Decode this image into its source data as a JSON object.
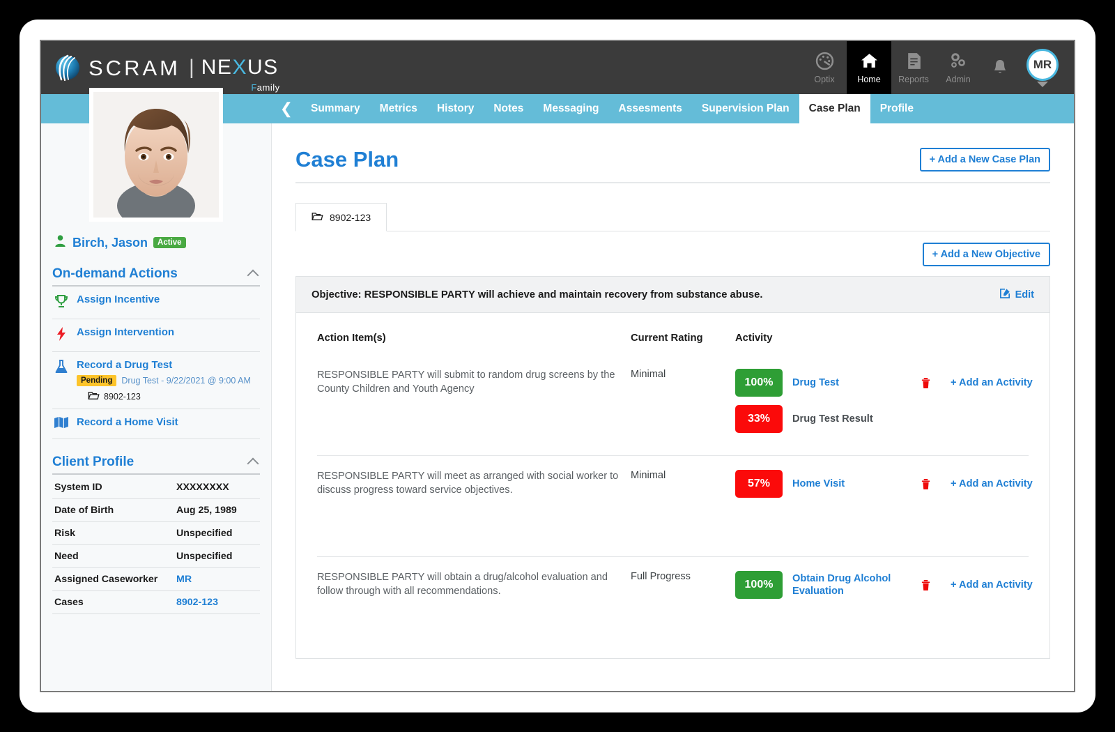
{
  "brand": {
    "name": "SCRAM",
    "separator": "|",
    "product_a": "NE",
    "product_x": "X",
    "product_b": "US",
    "product_sub_f": "F",
    "product_sub_rest": "amily",
    "accent_blue": "#49b8e0"
  },
  "topnav": {
    "items": [
      {
        "label": "Optix",
        "icon": "gauge-icon",
        "active": false
      },
      {
        "label": "Home",
        "icon": "home-icon",
        "active": true
      },
      {
        "label": "Reports",
        "icon": "document-icon",
        "active": false
      },
      {
        "label": "Admin",
        "icon": "gears-icon",
        "active": false
      }
    ],
    "bell_icon": "bell-icon",
    "user_initials": "MR"
  },
  "tabbar": {
    "back_glyph": "❮",
    "tabs": [
      {
        "label": "Summary",
        "active": false
      },
      {
        "label": "Metrics",
        "active": false
      },
      {
        "label": "History",
        "active": false
      },
      {
        "label": "Notes",
        "active": false
      },
      {
        "label": "Messaging",
        "active": false
      },
      {
        "label": "Assesments",
        "active": false
      },
      {
        "label": "Supervision Plan",
        "active": false
      },
      {
        "label": "Case Plan",
        "active": true
      },
      {
        "label": "Profile",
        "active": false
      }
    ]
  },
  "sidebar": {
    "client_name": "Birch, Jason",
    "status_badge": "Active",
    "ondemand": {
      "title": "On-demand Actions",
      "items": [
        {
          "label": "Assign Incentive",
          "icon": "trophy-icon"
        },
        {
          "label": "Assign Intervention",
          "icon": "lightning-bolt-icon"
        },
        {
          "label": "Record a Drug Test",
          "icon": "flask-icon",
          "pending_badge": "Pending",
          "pending_text": "Drug Test - 9/22/2021 @ 9:00 AM",
          "case_number": "8902-123"
        },
        {
          "label": "Record a Home Visit",
          "icon": "map-icon"
        }
      ]
    },
    "client_profile": {
      "title": "Client Profile",
      "rows": [
        {
          "key": "System ID",
          "value": "XXXXXXXX",
          "link": false
        },
        {
          "key": "Date of Birth",
          "value": "Aug 25, 1989",
          "link": false
        },
        {
          "key": "Risk",
          "value": "Unspecified",
          "link": false
        },
        {
          "key": "Need",
          "value": "Unspecified",
          "link": false
        },
        {
          "key": "Assigned Caseworker",
          "value": "MR",
          "link": true
        },
        {
          "key": "Cases",
          "value": "8902-123",
          "link": true
        }
      ]
    }
  },
  "main": {
    "page_title": "Case Plan",
    "add_case_plan_label": "+ Add a New Case Plan",
    "case_tab_label": "8902-123",
    "add_objective_label": "+ Add a New Objective",
    "objective_text": "Objective: RESPONSIBLE PARTY will achieve and maintain recovery from substance abuse.",
    "edit_label": "Edit",
    "columns": {
      "action": "Action Item(s)",
      "rating": "Current Rating",
      "activity": "Activity"
    },
    "add_activity_label": "+ Add an Activity",
    "colors": {
      "green": "#2e9e35",
      "red": "#fb0a0a",
      "link_blue": "#1f7fd4"
    },
    "rows": [
      {
        "action": "RESPONSIBLE PARTY will submit to random drug screens by the County Children and Youth Agency",
        "rating": "Minimal",
        "activities": [
          {
            "pct": "100%",
            "color": "#2e9e35",
            "name": "Drug Test",
            "is_link": true
          },
          {
            "pct": "33%",
            "color": "#fb0a0a",
            "name": "Drug Test Result",
            "is_link": false
          }
        ]
      },
      {
        "action": "RESPONSIBLE PARTY will meet as arranged with social worker to discuss progress toward service objectives.",
        "rating": "Minimal",
        "activities": [
          {
            "pct": "57%",
            "color": "#fb0a0a",
            "name": "Home Visit",
            "is_link": true
          }
        ]
      },
      {
        "action": "RESPONSIBLE PARTY will obtain a drug/alcohol evaluation and follow through with all recommendations.",
        "rating": "Full Progress",
        "activities": [
          {
            "pct": "100%",
            "color": "#2e9e35",
            "name": "Obtain Drug Alcohol Evaluation",
            "is_link": true
          }
        ]
      }
    ]
  }
}
